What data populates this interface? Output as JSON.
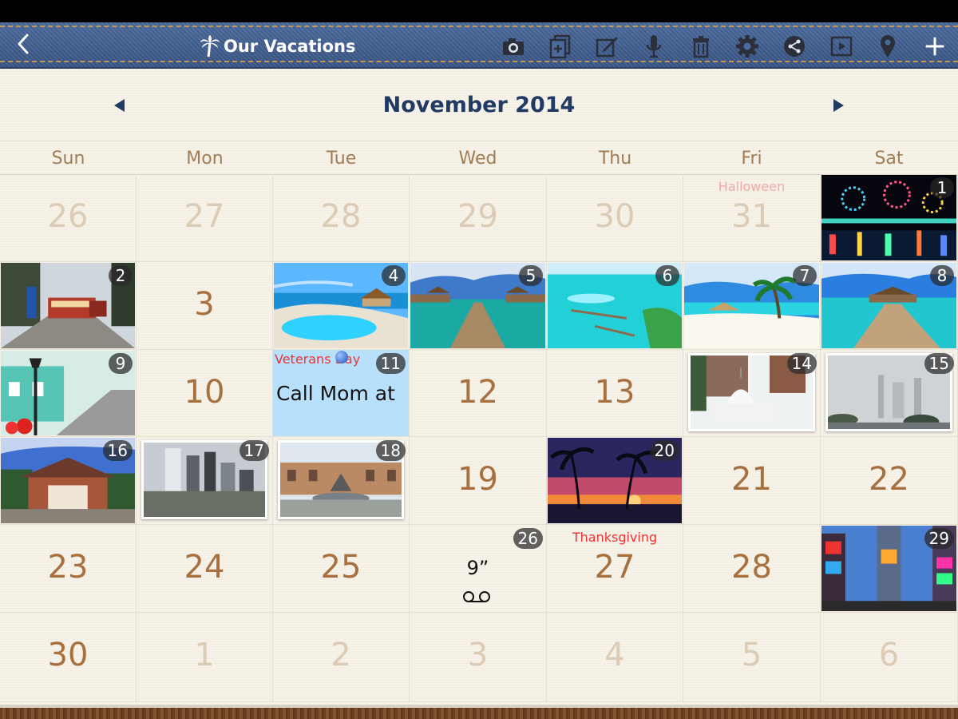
{
  "app": {
    "title": "Our Vacations",
    "back_icon": "back-arrow-icon",
    "palm_icon": "palm-tree-icon",
    "toolbar_icons": [
      "camera-icon",
      "add-page-icon",
      "edit-icon",
      "microphone-icon",
      "trash-icon",
      "settings-gear-icon",
      "share-icon",
      "slideshow-icon",
      "location-pin-icon",
      "add-icon"
    ]
  },
  "calendar": {
    "month_label": "November 2014",
    "weekdays": [
      "Sun",
      "Mon",
      "Tue",
      "Wed",
      "Thu",
      "Fri",
      "Sat"
    ],
    "colors": {
      "accent": "#213a63",
      "daynum": "#a7703e",
      "daynum_dim": "#dccbb5",
      "holiday": "#e33333"
    },
    "cells": [
      {
        "day": "26",
        "dim": true
      },
      {
        "day": "27",
        "dim": true
      },
      {
        "day": "28",
        "dim": true
      },
      {
        "day": "29",
        "dim": true
      },
      {
        "day": "30",
        "dim": true
      },
      {
        "day": "31",
        "dim": true,
        "holiday": "Halloween"
      },
      {
        "day": "1",
        "photo": "fireworks-night-photo"
      },
      {
        "day": "2",
        "photo": "cable-car-street-photo"
      },
      {
        "day": "3"
      },
      {
        "day": "4",
        "photo": "resort-pool-photo"
      },
      {
        "day": "5",
        "photo": "overwater-pier-photo"
      },
      {
        "day": "6",
        "photo": "island-lagoon-photo"
      },
      {
        "day": "7",
        "photo": "beach-palm-photo"
      },
      {
        "day": "8",
        "photo": "ocean-boardwalk-photo"
      },
      {
        "day": "9",
        "photo": "street-lamp-photo"
      },
      {
        "day": "10"
      },
      {
        "day": "11",
        "holiday": "Veterans Day",
        "memo": "Call Mom at"
      },
      {
        "day": "12"
      },
      {
        "day": "13"
      },
      {
        "day": "14",
        "photo": "mosque-photo",
        "framed": true
      },
      {
        "day": "15",
        "photo": "foggy-city-photo",
        "framed": true
      },
      {
        "day": "16",
        "photo": "temple-photo"
      },
      {
        "day": "17",
        "photo": "skyscrapers-photo",
        "framed": true
      },
      {
        "day": "18",
        "photo": "fountain-square-photo",
        "framed": true
      },
      {
        "day": "19"
      },
      {
        "day": "20",
        "photo": "sunset-palms-photo"
      },
      {
        "day": "21"
      },
      {
        "day": "22"
      },
      {
        "day": "23"
      },
      {
        "day": "24"
      },
      {
        "day": "25"
      },
      {
        "day": "26",
        "voice_duration": "9”"
      },
      {
        "day": "27",
        "holiday": "Thanksgiving"
      },
      {
        "day": "28"
      },
      {
        "day": "29",
        "photo": "times-square-photo"
      },
      {
        "day": "30"
      },
      {
        "day": "1",
        "dim": true
      },
      {
        "day": "2",
        "dim": true
      },
      {
        "day": "3",
        "dim": true
      },
      {
        "day": "4",
        "dim": true
      },
      {
        "day": "5",
        "dim": true
      },
      {
        "day": "6",
        "dim": true
      }
    ]
  }
}
